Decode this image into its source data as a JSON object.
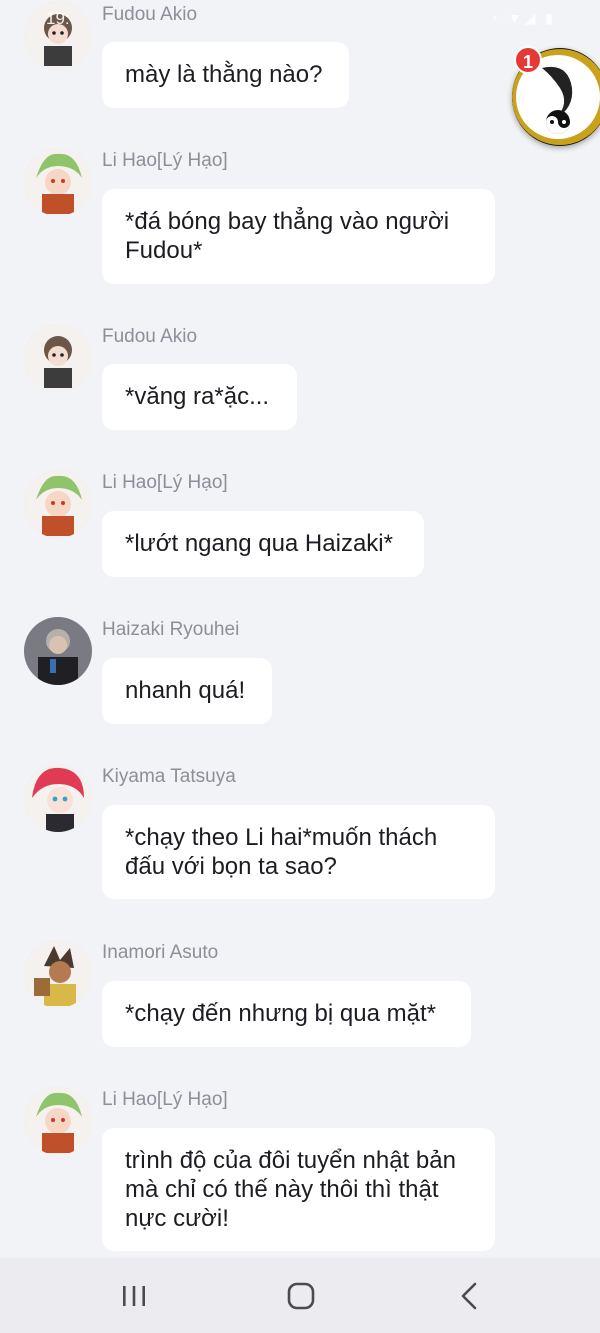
{
  "status_bar": {
    "time": "19:",
    "icons": "◔ ▼◢ ▮"
  },
  "floating_bubble": {
    "badge_count": "1",
    "icon": "yin-yang-dragon-icon"
  },
  "messages": [
    {
      "sender": "Fudou Akio",
      "text": "mày là thằng nào?",
      "avatar": "fudou-avatar"
    },
    {
      "sender": "Li Hao[Lý Hạo]",
      "text": "*đá bóng bay thẳng vào người Fudou*",
      "avatar": "lihao-avatar"
    },
    {
      "sender": "Fudou Akio",
      "text": "*văng ra*ặc...",
      "avatar": "fudou-avatar"
    },
    {
      "sender": "Li Hao[Lý Hạo]",
      "text": "*lướt ngang qua Haizaki*",
      "avatar": "lihao-avatar"
    },
    {
      "sender": "Haizaki Ryouhei",
      "text": "nhanh quá!",
      "avatar": "haizaki-avatar"
    },
    {
      "sender": "Kiyama Tatsuya",
      "text": "*chạy theo Li hai*muốn thách đấu với bọn ta sao?",
      "avatar": "kiyama-avatar"
    },
    {
      "sender": "Inamori Asuto",
      "text": "*chạy đến nhưng bị qua mặt*",
      "avatar": "inamori-avatar"
    },
    {
      "sender": "Li Hao[Lý Hạo]",
      "text": "trình độ của đôi tuyển nhật bản mà chỉ có thế này thôi thì thật nực cười!",
      "avatar": "lihao-avatar"
    }
  ],
  "nav_bar": {
    "recent": "recent-apps-icon",
    "home": "home-icon",
    "back": "back-icon"
  },
  "colors": {
    "background": "#f2f3f7",
    "bubble": "#ffffff",
    "name": "#8c8f98",
    "text": "#1c1d22",
    "badge": "#e53935"
  }
}
